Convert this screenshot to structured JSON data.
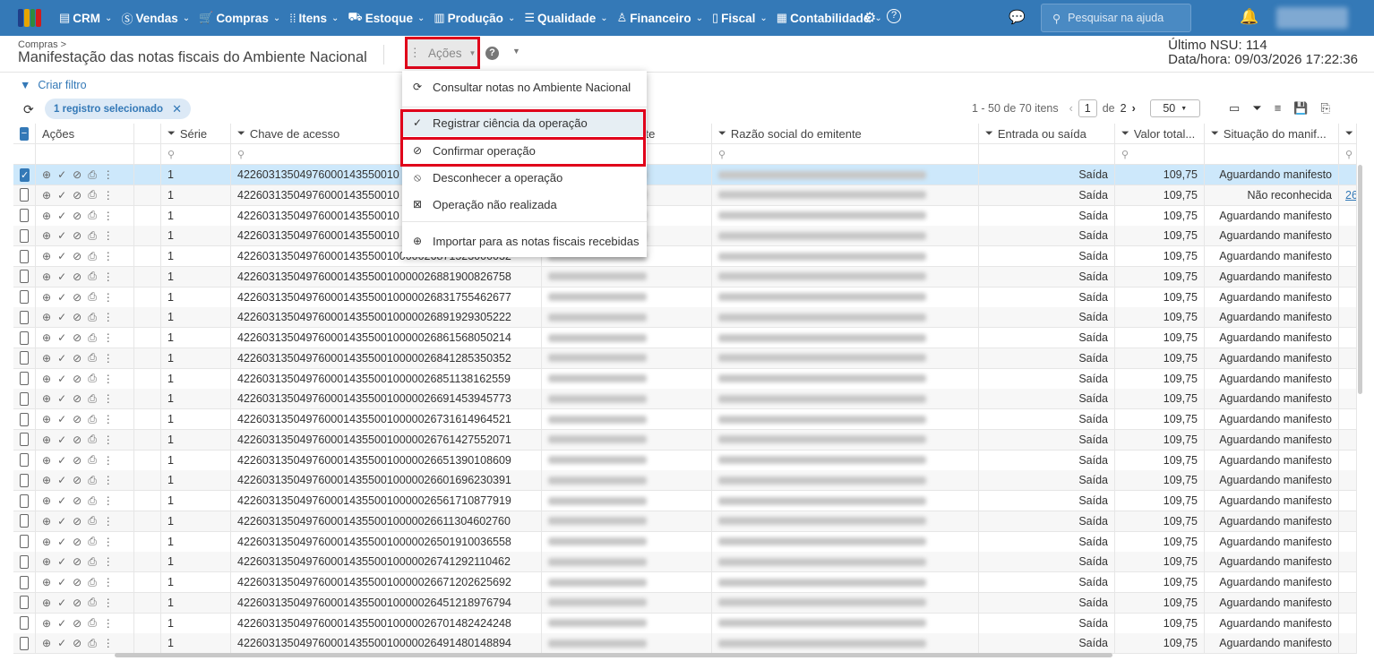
{
  "topbar": {
    "logo_colors": [
      "#1f3f8a",
      "#e8a400",
      "#2e8b3e",
      "#d01c1c"
    ],
    "nav": [
      {
        "label": "CRM",
        "icon": "crm-icon",
        "glyph": "▤"
      },
      {
        "label": "Vendas",
        "icon": "dollar-icon",
        "glyph": "Ⓢ"
      },
      {
        "label": "Compras",
        "icon": "cart-icon",
        "glyph": "🛒"
      },
      {
        "label": "Itens",
        "icon": "items-icon",
        "glyph": "⁞⁞"
      },
      {
        "label": "Estoque",
        "icon": "stock-icon",
        "glyph": "⛟"
      },
      {
        "label": "Produção",
        "icon": "factory-icon",
        "glyph": "▥"
      },
      {
        "label": "Qualidade",
        "icon": "quality-icon",
        "glyph": "☰"
      },
      {
        "label": "Financeiro",
        "icon": "money-bag-icon",
        "glyph": "♙"
      },
      {
        "label": "Fiscal",
        "icon": "fiscal-doc-icon",
        "glyph": "▯"
      },
      {
        "label": "Contabilidade",
        "icon": "calculator-icon",
        "glyph": "▦"
      }
    ],
    "search_placeholder": "Pesquisar na ajuda"
  },
  "header": {
    "breadcrumb": "Compras >",
    "title": "Manifestação das notas fiscais do Ambiente Nacional",
    "actions_label": "Ações",
    "nsu": "Último NSU: 114",
    "datetime": "Data/hora: 09/03/2026 17:22:36"
  },
  "toolbar": {
    "create_filter": "Criar filtro",
    "selected_chip": "1 registro selecionado",
    "pager_text": "1 - 50 de 70 itens",
    "page": "1",
    "of": "de",
    "total_pages": "2",
    "page_size": "50"
  },
  "columns": [
    "Ações",
    "Série",
    "Chave de acesso",
    "CNPJ do emitente",
    "Razão social do emitente",
    "Entrada ou saída",
    "Valor total...",
    "Situação do manif..."
  ],
  "menu": [
    {
      "label": "Consultar notas no Ambiente Nacional",
      "icon": "refresh-icon",
      "glyph": "⟳"
    },
    {
      "label": "Registrar ciência da operação",
      "icon": "check-icon",
      "glyph": "✓"
    },
    {
      "label": "Confirmar operação",
      "icon": "check-circle-icon",
      "glyph": "⊘"
    },
    {
      "label": "Desconhecer a operação",
      "icon": "block-icon",
      "glyph": "⦸"
    },
    {
      "label": "Operação não realizada",
      "icon": "cancelled-icon",
      "glyph": "⊠"
    },
    {
      "label": "Importar para as notas fiscais recebidas",
      "icon": "plus-circle-icon",
      "glyph": "⊕"
    }
  ],
  "rows": [
    {
      "serie": "1",
      "chave": "42260313504976000143550010",
      "tipo": "Saída",
      "valor": "109,75",
      "situacao": "Aguardando manifesto",
      "selected": true
    },
    {
      "serie": "1",
      "chave": "42260313504976000143550010",
      "tipo": "Saída",
      "valor": "109,75",
      "situacao": "Não reconhecida",
      "link": "26"
    },
    {
      "serie": "1",
      "chave": "42260313504976000143550010",
      "tipo": "Saída",
      "valor": "109,75",
      "situacao": "Aguardando manifesto"
    },
    {
      "serie": "1",
      "chave": "42260313504976000143550010",
      "tipo": "Saída",
      "valor": "109,75",
      "situacao": "Aguardando manifesto"
    },
    {
      "serie": "1",
      "chave": "42260313504976000143550010000026871523000032",
      "tipo": "Saída",
      "valor": "109,75",
      "situacao": "Aguardando manifesto"
    },
    {
      "serie": "1",
      "chave": "42260313504976000143550010000026881900826758",
      "tipo": "Saída",
      "valor": "109,75",
      "situacao": "Aguardando manifesto"
    },
    {
      "serie": "1",
      "chave": "42260313504976000143550010000026831755462677",
      "tipo": "Saída",
      "valor": "109,75",
      "situacao": "Aguardando manifesto"
    },
    {
      "serie": "1",
      "chave": "42260313504976000143550010000026891929305222",
      "tipo": "Saída",
      "valor": "109,75",
      "situacao": "Aguardando manifesto"
    },
    {
      "serie": "1",
      "chave": "42260313504976000143550010000026861568050214",
      "tipo": "Saída",
      "valor": "109,75",
      "situacao": "Aguardando manifesto"
    },
    {
      "serie": "1",
      "chave": "42260313504976000143550010000026841285350352",
      "tipo": "Saída",
      "valor": "109,75",
      "situacao": "Aguardando manifesto"
    },
    {
      "serie": "1",
      "chave": "42260313504976000143550010000026851138162559",
      "tipo": "Saída",
      "valor": "109,75",
      "situacao": "Aguardando manifesto"
    },
    {
      "serie": "1",
      "chave": "42260313504976000143550010000026691453945773",
      "tipo": "Saída",
      "valor": "109,75",
      "situacao": "Aguardando manifesto"
    },
    {
      "serie": "1",
      "chave": "42260313504976000143550010000026731614964521",
      "tipo": "Saída",
      "valor": "109,75",
      "situacao": "Aguardando manifesto"
    },
    {
      "serie": "1",
      "chave": "42260313504976000143550010000026761427552071",
      "tipo": "Saída",
      "valor": "109,75",
      "situacao": "Aguardando manifesto"
    },
    {
      "serie": "1",
      "chave": "42260313504976000143550010000026651390108609",
      "tipo": "Saída",
      "valor": "109,75",
      "situacao": "Aguardando manifesto"
    },
    {
      "serie": "1",
      "chave": "42260313504976000143550010000026601696230391",
      "tipo": "Saída",
      "valor": "109,75",
      "situacao": "Aguardando manifesto"
    },
    {
      "serie": "1",
      "chave": "42260313504976000143550010000026561710877919",
      "tipo": "Saída",
      "valor": "109,75",
      "situacao": "Aguardando manifesto"
    },
    {
      "serie": "1",
      "chave": "42260313504976000143550010000026611304602760",
      "tipo": "Saída",
      "valor": "109,75",
      "situacao": "Aguardando manifesto"
    },
    {
      "serie": "1",
      "chave": "42260313504976000143550010000026501910036558",
      "tipo": "Saída",
      "valor": "109,75",
      "situacao": "Aguardando manifesto"
    },
    {
      "serie": "1",
      "chave": "42260313504976000143550010000026741292110462",
      "tipo": "Saída",
      "valor": "109,75",
      "situacao": "Aguardando manifesto"
    },
    {
      "serie": "1",
      "chave": "42260313504976000143550010000026671202625692",
      "tipo": "Saída",
      "valor": "109,75",
      "situacao": "Aguardando manifesto"
    },
    {
      "serie": "1",
      "chave": "42260313504976000143550010000026451218976794",
      "tipo": "Saída",
      "valor": "109,75",
      "situacao": "Aguardando manifesto"
    },
    {
      "serie": "1",
      "chave": "42260313504976000143550010000026701482424248",
      "tipo": "Saída",
      "valor": "109,75",
      "situacao": "Aguardando manifesto"
    },
    {
      "serie": "1",
      "chave": "42260313504976000143550010000026491480148894",
      "tipo": "Saída",
      "valor": "109,75",
      "situacao": "Aguardando manifesto"
    }
  ]
}
